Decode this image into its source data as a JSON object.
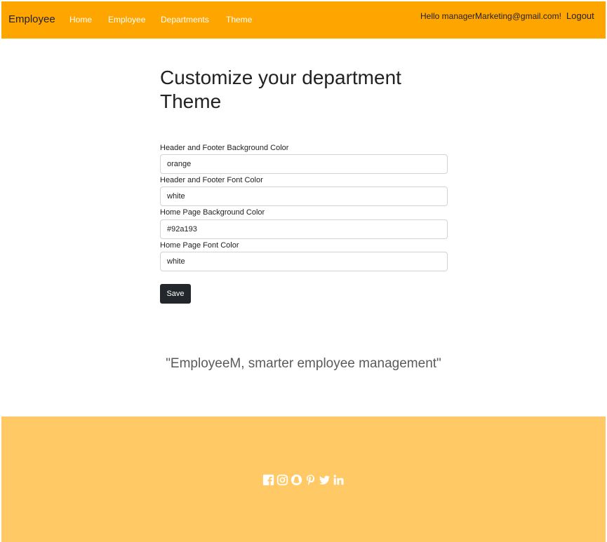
{
  "navbar": {
    "brand": "Employee",
    "links": [
      "Home",
      "Employee",
      "Departments",
      "Theme"
    ],
    "greeting": "Hello managerMarketing@gmail.com!",
    "logout": "Logout",
    "background_color": "#ffa500",
    "font_color": "#ffffff"
  },
  "form": {
    "title": "Customize your department Theme",
    "fields": [
      {
        "label": "Header and Footer Background Color",
        "value": "orange"
      },
      {
        "label": "Header and Footer Font Color",
        "value": "white"
      },
      {
        "label": "Home Page Background Color",
        "value": "#92a193"
      },
      {
        "label": "Home Page Font Color",
        "value": "white"
      }
    ],
    "save_label": "Save"
  },
  "tagline": "\"EmployeeM, smarter employee management\"",
  "footer": {
    "background_color": "#ffc966",
    "social_icons": [
      "facebook-icon",
      "instagram-icon",
      "snapchat-icon",
      "pinterest-icon",
      "twitter-icon",
      "linkedin-icon"
    ]
  }
}
